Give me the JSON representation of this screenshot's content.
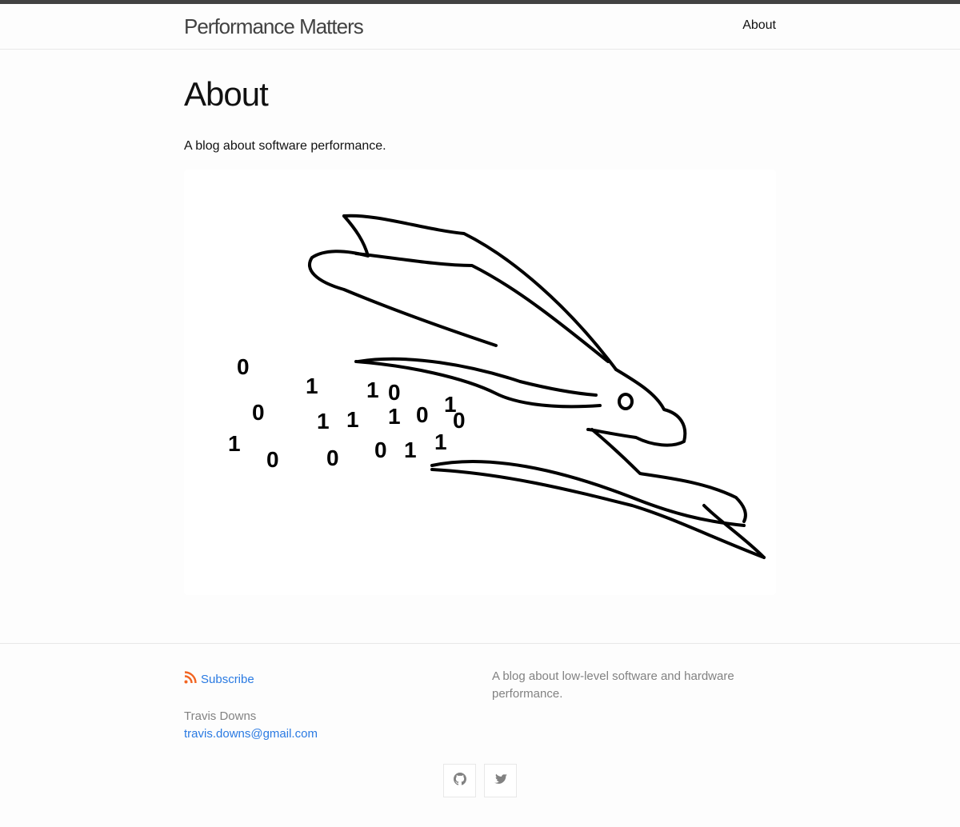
{
  "header": {
    "site_title": "Performance Matters",
    "nav": [
      {
        "label": "About"
      }
    ]
  },
  "main": {
    "title": "About",
    "description": "A blog about software performance."
  },
  "footer": {
    "subscribe_label": "Subscribe",
    "author": "Travis Downs",
    "email": "travis.downs@gmail.com",
    "tagline": "A blog about low-level software and hardware performance."
  },
  "icons": {
    "rss": "rss-icon",
    "github": "github-icon",
    "twitter": "twitter-icon"
  },
  "colors": {
    "link": "#2a7ae2",
    "rss": "#f26522",
    "muted": "#828282"
  }
}
